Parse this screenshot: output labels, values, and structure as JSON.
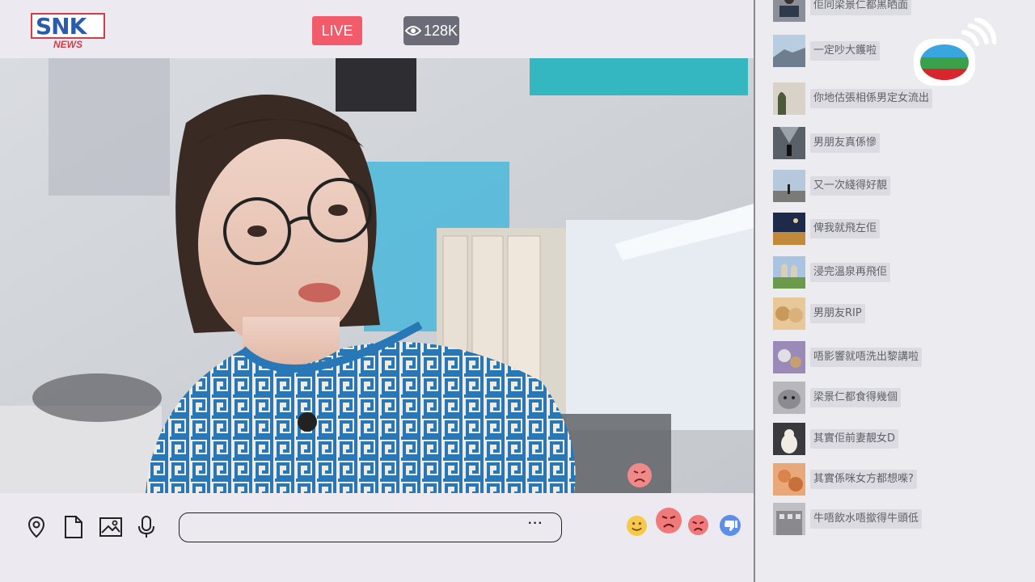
{
  "header": {
    "logo_text": "SNK",
    "logo_sub": "NEWS",
    "live_label": "LIVE",
    "viewer_count": "128K",
    "viewer_icon": "eye-icon"
  },
  "bottom_bar": {
    "tools": [
      "location-pin-icon",
      "document-icon",
      "image-icon",
      "microphone-icon"
    ],
    "message_input": {
      "value": "",
      "placeholder": ""
    },
    "more_label": "···",
    "reactions": [
      "smile-emoji",
      "angry-emoji-large",
      "angry-emoji",
      "thumbs-down-icon"
    ]
  },
  "chat": {
    "messages": [
      {
        "text": "佢同梁景仁都黑晒面",
        "avatar": "avatar-person-laptop"
      },
      {
        "text": "一定吵大鑊啦",
        "avatar": "avatar-mountain"
      },
      {
        "text": "你地估張相係男定女流出",
        "avatar": "avatar-plant"
      },
      {
        "text": "男朋友真係慘",
        "avatar": "avatar-corridor"
      },
      {
        "text": "又一次綫得好靚",
        "avatar": "avatar-street"
      },
      {
        "text": "俾我就飛左佢",
        "avatar": "avatar-night-city"
      },
      {
        "text": "浸完溫泉再飛佢",
        "avatar": "avatar-castle"
      },
      {
        "text": "男朋友RIP",
        "avatar": "avatar-cats"
      },
      {
        "text": "唔影響就唔洗出黎講啦",
        "avatar": "avatar-objects"
      },
      {
        "text": "梁景仁都食得幾個",
        "avatar": "avatar-cat-grey"
      },
      {
        "text": "其實佢前妻靚女D",
        "avatar": "avatar-dog"
      },
      {
        "text": "其實係咪女方都想喍?",
        "avatar": "avatar-food"
      },
      {
        "text": "牛唔飲水唔撳得牛頭低",
        "avatar": "avatar-building"
      }
    ]
  },
  "overlay": {
    "broadcaster_logo": "tvb-logo"
  },
  "colors": {
    "live": "#f25c6a",
    "viewers": "#6c6c78",
    "brand_red": "#d33b47",
    "brand_blue": "#2a5caa",
    "thumbs": "#5b8fe8"
  }
}
